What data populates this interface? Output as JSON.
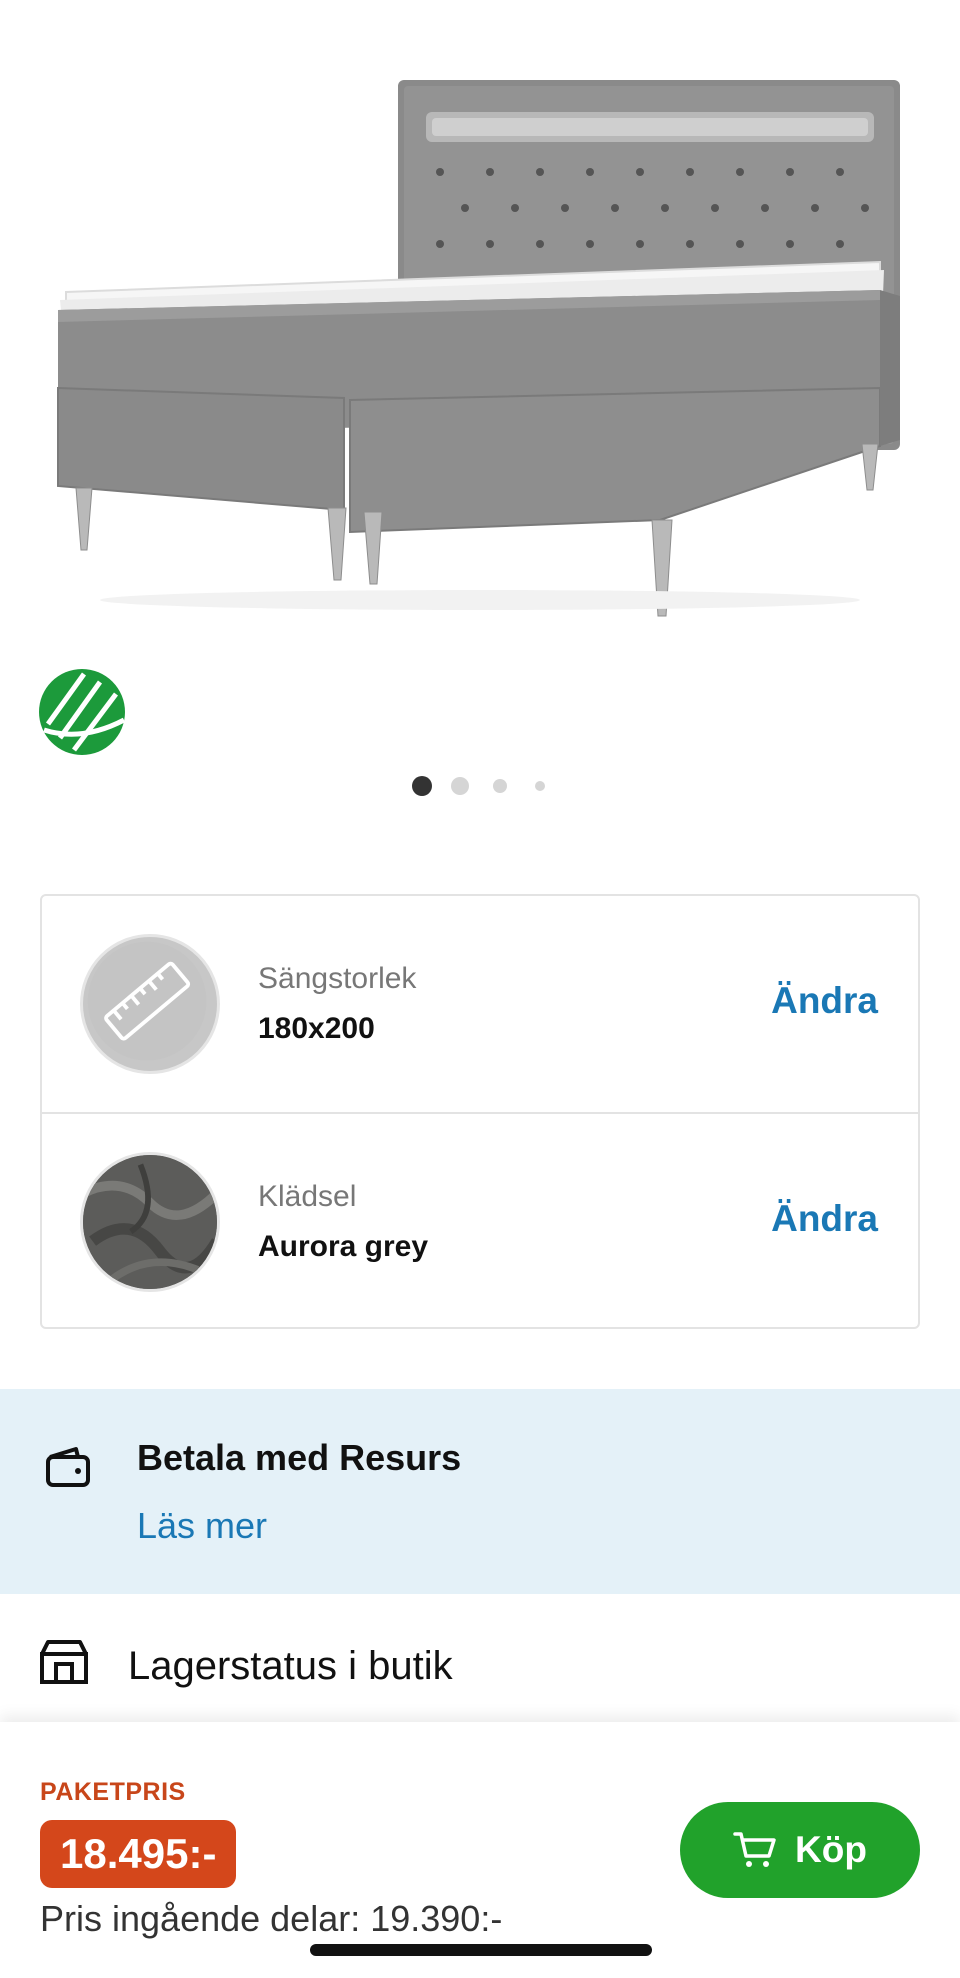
{
  "gallery": {
    "image_name": "boxspring-bed-grey",
    "eco_label": "nordic-swan-ecolabel",
    "page_count": 4,
    "active_page": 1
  },
  "config": {
    "rows": [
      {
        "label": "Sängstorlek",
        "value": "180x200",
        "action": "Ändra",
        "thumb": "ruler-icon"
      },
      {
        "label": "Klädsel",
        "value": "Aurora grey",
        "action": "Ändra",
        "thumb": "fabric-swatch"
      }
    ]
  },
  "resurs": {
    "title": "Betala med Resurs",
    "link": "Läs mer",
    "icon": "wallet-icon"
  },
  "stock": {
    "label": "Lagerstatus i butik",
    "icon": "store-icon"
  },
  "bottom_bar": {
    "tag": "PAKETPRIS",
    "price": "18.495:-",
    "parts_price": "Pris ingående delar: 19.390:-",
    "buy_label": "Köp",
    "buy_icon": "cart-icon"
  },
  "colors": {
    "accent_blue": "#1a78b5",
    "price_red": "#d4471b",
    "buy_green": "#21a22b",
    "info_bg": "#e4f1f8"
  }
}
